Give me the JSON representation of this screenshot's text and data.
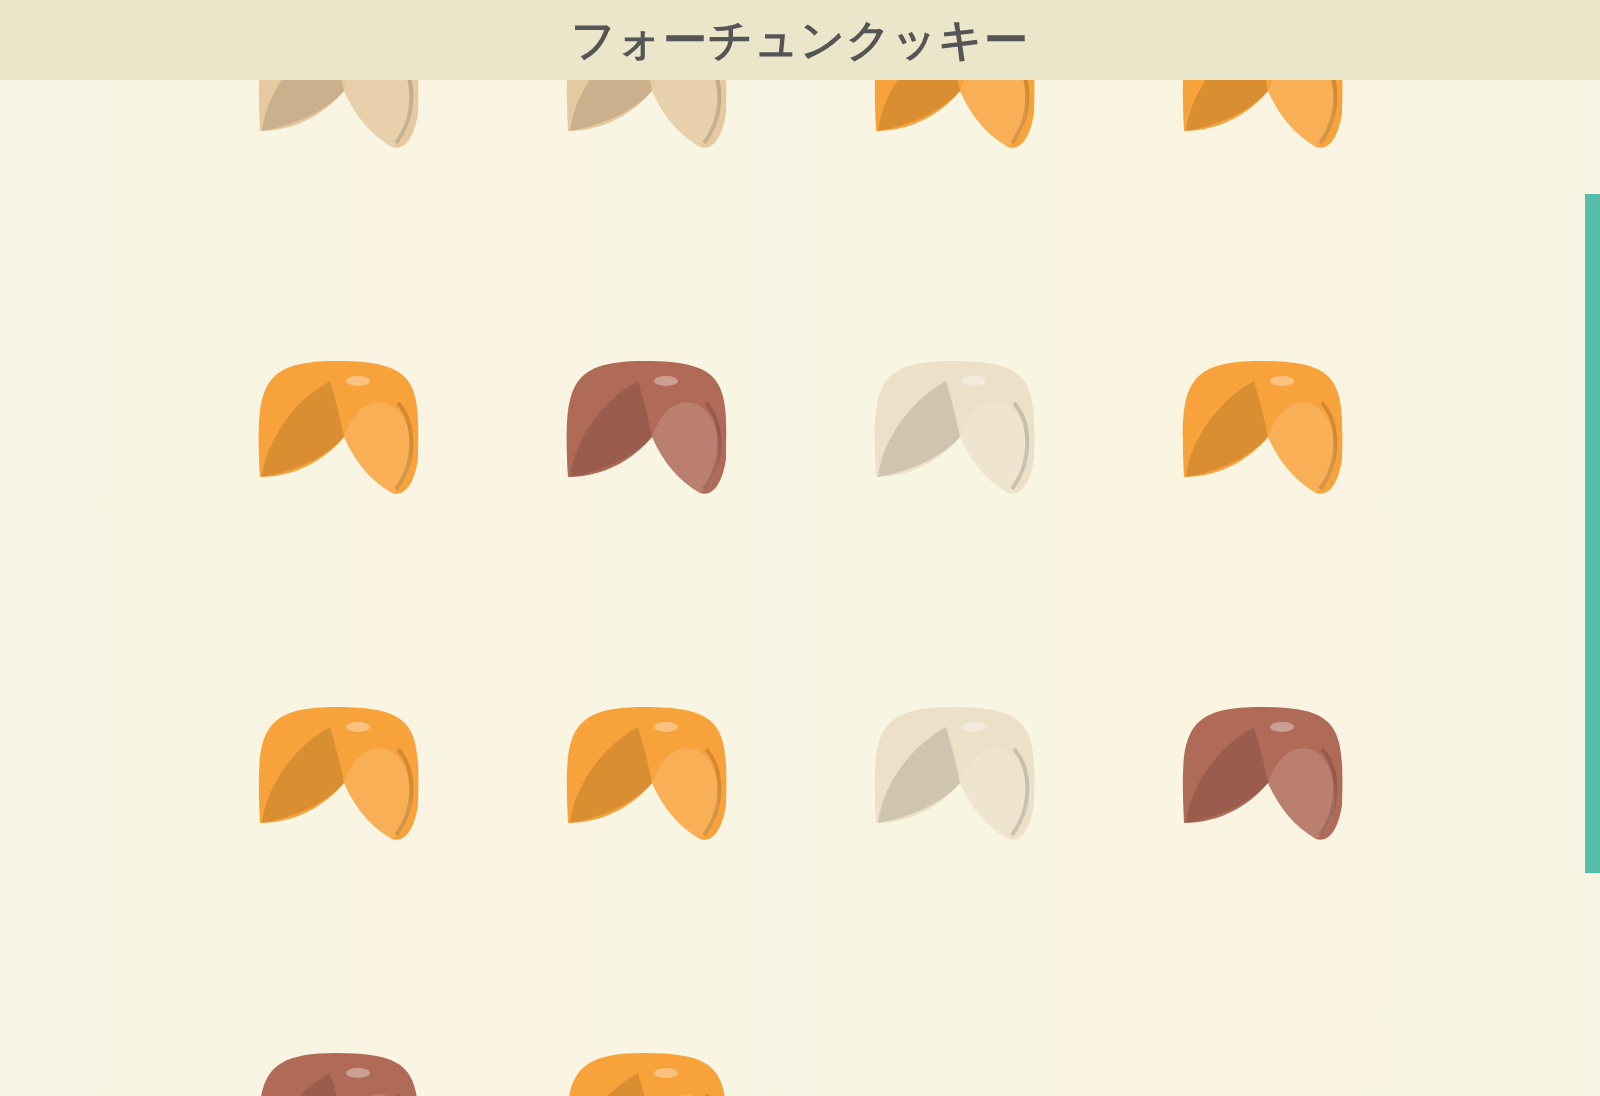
{
  "header": {
    "title": "フォーチュンクッキー"
  },
  "cookies": [
    {
      "color": "#e6c9a0"
    },
    {
      "color": "#e6c9a0"
    },
    {
      "color": "#f7a23a"
    },
    {
      "color": "#f7a23a"
    },
    {
      "color": "#f7a23a"
    },
    {
      "color": "#b06a58"
    },
    {
      "color": "#ece0c8"
    },
    {
      "color": "#f7a23a"
    },
    {
      "color": "#f7a23a"
    },
    {
      "color": "#f7a23a"
    },
    {
      "color": "#ece0c8"
    },
    {
      "color": "#b06a58"
    },
    {
      "color": "#b06a58"
    },
    {
      "color": "#f7a23a"
    }
  ]
}
